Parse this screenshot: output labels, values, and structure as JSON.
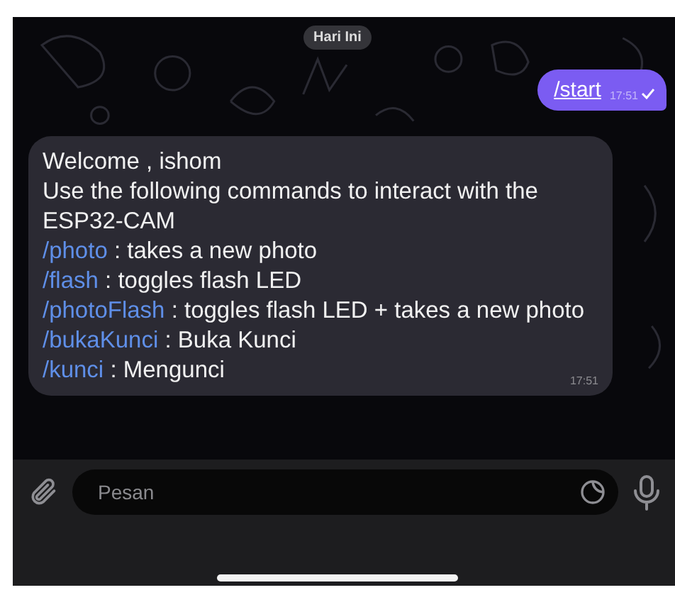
{
  "date_label": "Hari Ini",
  "messages": [
    {
      "kind": "outgoing",
      "text": "/start",
      "time": "17:51"
    },
    {
      "kind": "incoming",
      "time": "17:51",
      "lines": [
        {
          "text": "Welcome , ishom"
        },
        {
          "text": "Use the following commands to interact with the ESP32-CAM"
        },
        {
          "command": "/photo",
          "text": " : takes a new photo"
        },
        {
          "command": "/flash",
          "text": " : toggles flash LED"
        },
        {
          "command": "/photoFlash",
          "text": " : toggles flash LED + takes a new photo"
        },
        {
          "command": "/bukaKunci",
          "text": " : Buka Kunci"
        },
        {
          "command": "/kunci",
          "text": " : Mengunci"
        }
      ]
    }
  ],
  "composer": {
    "placeholder": "Pesan"
  }
}
